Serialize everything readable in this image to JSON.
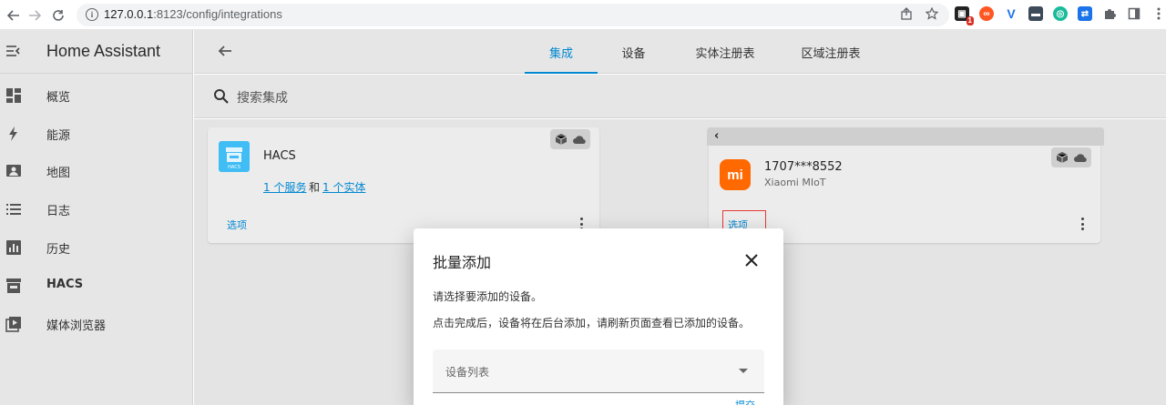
{
  "browser": {
    "url_host": "127.0.0.1",
    "url_rest": ":8123/config/integrations",
    "ext_badge": "1"
  },
  "app": {
    "title": "Home Assistant"
  },
  "sidebar": {
    "items": [
      {
        "label": "概览",
        "icon": "dashboard-icon"
      },
      {
        "label": "能源",
        "icon": "lightning-icon"
      },
      {
        "label": "地图",
        "icon": "map-icon"
      },
      {
        "label": "日志",
        "icon": "list-icon"
      },
      {
        "label": "历史",
        "icon": "chart-icon"
      },
      {
        "label": "HACS",
        "icon": "hacs-icon"
      },
      {
        "label": "媒体浏览器",
        "icon": "media-icon"
      }
    ]
  },
  "header": {
    "tabs": [
      {
        "label": "集成",
        "active": true
      },
      {
        "label": "设备",
        "active": false
      },
      {
        "label": "实体注册表",
        "active": false
      },
      {
        "label": "区域注册表",
        "active": false
      }
    ]
  },
  "search": {
    "placeholder": "搜索集成"
  },
  "cards": {
    "hacs": {
      "title": "HACS",
      "logo_text": "HACS",
      "services_link": "1 个服务",
      "and_text": "和",
      "entities_link": "1 个实体",
      "options": "选项"
    },
    "xiaomi": {
      "title": "1707***8552",
      "subtitle": "Xiaomi MIoT",
      "logo_text": "mi",
      "options": "选项"
    }
  },
  "dialog": {
    "title": "批量添加",
    "line1": "请选择要添加的设备。",
    "line2": "点击完成后，设备将在后台添加，请刷新页面查看已添加的设备。",
    "select_label": "设备列表",
    "submit": "提交"
  },
  "colors": {
    "accent": "#0288d1",
    "hacs_blue": "#41bdf5",
    "xiaomi_orange": "#ff6900",
    "highlight_red": "#e53935"
  }
}
